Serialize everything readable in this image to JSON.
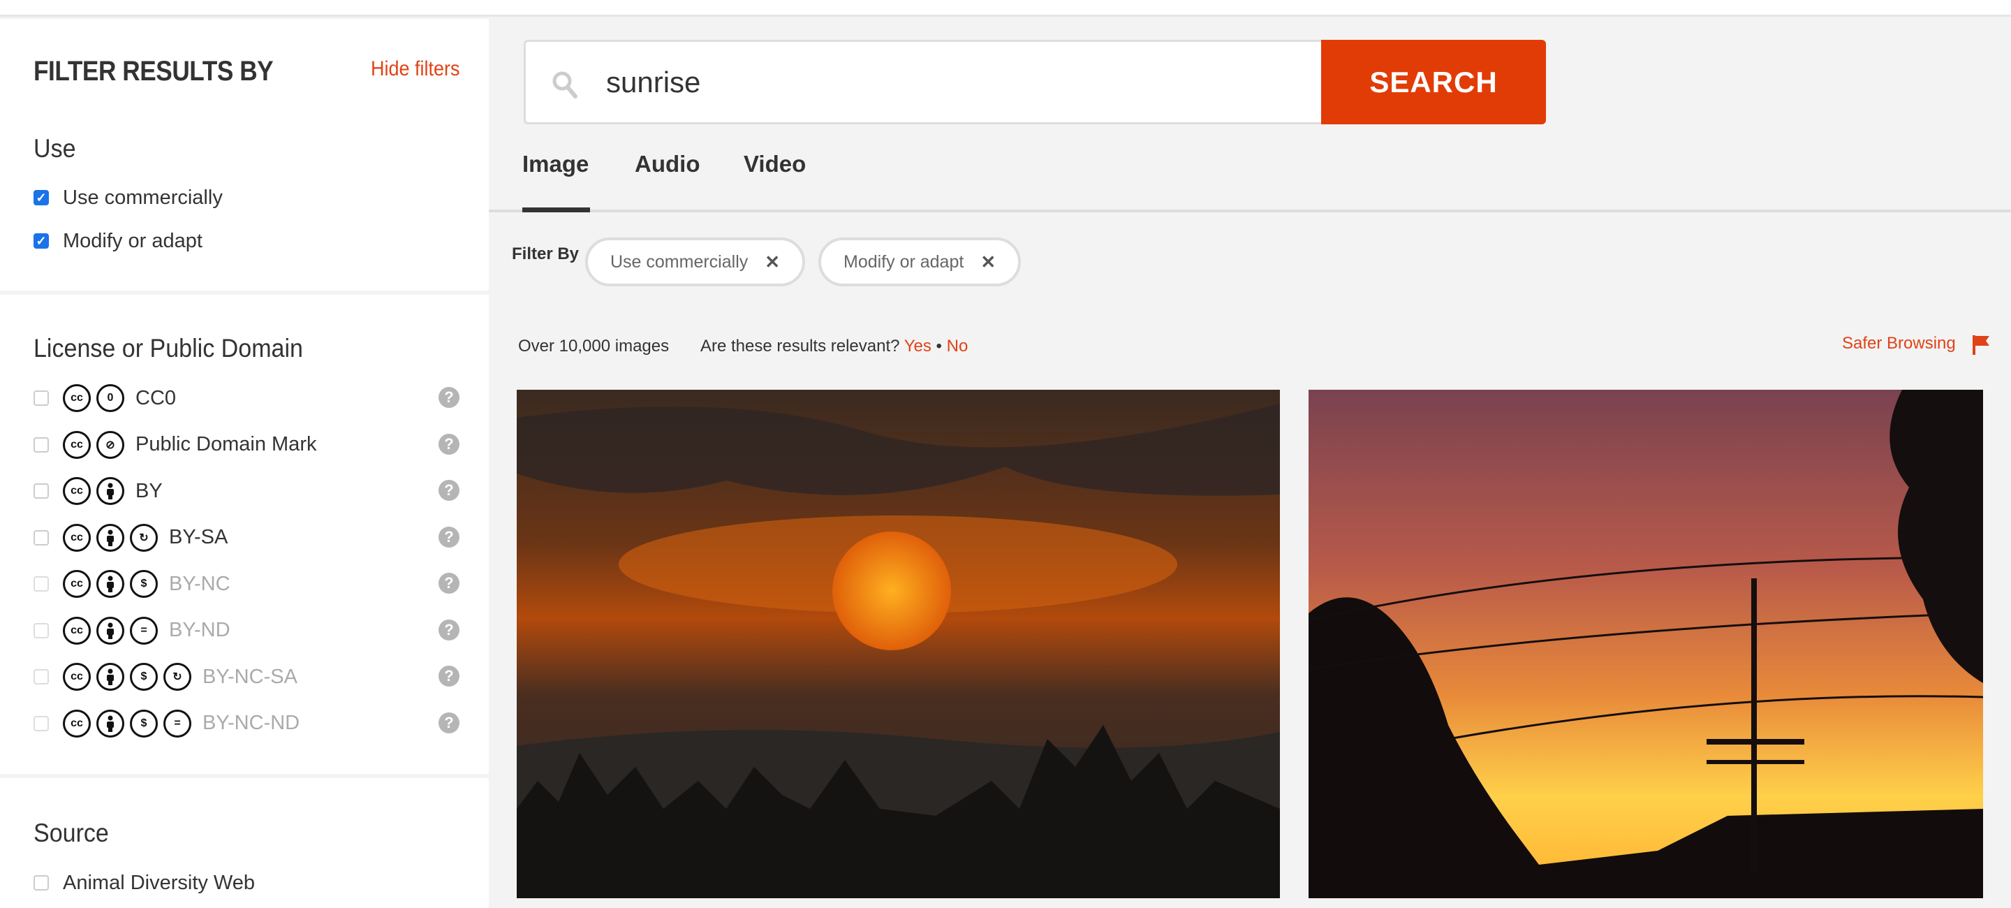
{
  "sidebar": {
    "title": "FILTER RESULTS BY",
    "hide_filters": "Hide filters",
    "use": {
      "heading": "Use",
      "items": [
        {
          "label": "Use commercially",
          "checked": true
        },
        {
          "label": "Modify or adapt",
          "checked": true
        }
      ]
    },
    "license": {
      "heading": "License or Public Domain",
      "items": [
        {
          "label": "CC0",
          "icons": [
            "cc",
            "zero"
          ],
          "disabled": false
        },
        {
          "label": "Public Domain Mark",
          "icons": [
            "cc",
            "pd"
          ],
          "disabled": false
        },
        {
          "label": "BY",
          "icons": [
            "cc",
            "by"
          ],
          "disabled": false
        },
        {
          "label": "BY-SA",
          "icons": [
            "cc",
            "by",
            "sa"
          ],
          "disabled": false
        },
        {
          "label": "BY-NC",
          "icons": [
            "cc",
            "by",
            "nc"
          ],
          "disabled": true
        },
        {
          "label": "BY-ND",
          "icons": [
            "cc",
            "by",
            "nd"
          ],
          "disabled": true
        },
        {
          "label": "BY-NC-SA",
          "icons": [
            "cc",
            "by",
            "nc",
            "sa"
          ],
          "disabled": true
        },
        {
          "label": "BY-NC-ND",
          "icons": [
            "cc",
            "by",
            "nc",
            "nd"
          ],
          "disabled": true
        }
      ],
      "help": "?"
    },
    "source": {
      "heading": "Source",
      "items": [
        {
          "label": "Animal Diversity Web",
          "checked": false
        }
      ]
    }
  },
  "search": {
    "value": "sunrise",
    "button": "SEARCH"
  },
  "tabs": [
    {
      "label": "Image",
      "active": true
    },
    {
      "label": "Audio"
    },
    {
      "label": "Video"
    }
  ],
  "filter_by": {
    "label": "Filter By",
    "chips": [
      "Use commercially",
      "Modify or adapt"
    ],
    "remove": "✕"
  },
  "results": {
    "count": "Over 10,000 images",
    "relevance_q": "Are these results relevant?",
    "yes": "Yes",
    "sep": "•",
    "no": "No",
    "safer": "Safer Browsing"
  },
  "colors": {
    "accent": "#e23c06",
    "link": "#e04317",
    "checkbox": "#1a73e8"
  }
}
